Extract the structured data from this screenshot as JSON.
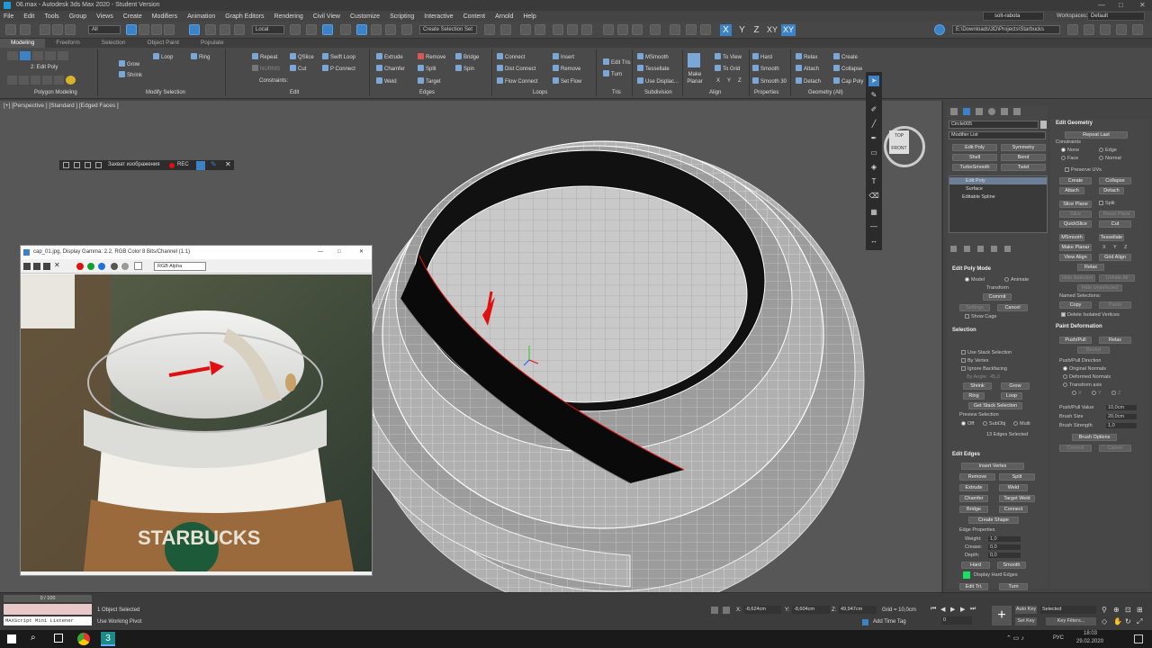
{
  "app": {
    "title": "06.max - Autodesk 3ds Max 2020 - Student Version",
    "menus": [
      "File",
      "Edit",
      "Tools",
      "Group",
      "Views",
      "Create",
      "Modifiers",
      "Animation",
      "Graph Editors",
      "Rendering",
      "Civil View",
      "Customize",
      "Scripting",
      "Interactive",
      "Content",
      "Arnold",
      "Help"
    ],
    "user": "solt-rabota",
    "workspace_label": "Workspaces:",
    "workspace_value": "Default"
  },
  "toolbar": {
    "filter_all": "All",
    "coord_local": "Local",
    "selection_set_placeholder": "Create Selection Set",
    "axis_x": "X",
    "axis_y": "Y",
    "axis_z": "Z",
    "axis_xy": "XY",
    "axis_xy2": "XY",
    "project_path": "E:\\Downloads\\3D\\Projects\\Starbucks"
  },
  "ribbon": {
    "tabs": [
      "Modeling",
      "Freeform",
      "Selection",
      "Object Paint",
      "Populate"
    ],
    "edit_poly_label": "2: Edit Poly",
    "groups": {
      "polygon_modeling": "Polygon Modeling",
      "modify_selection": "Modify Selection",
      "edit": "Edit",
      "edges": "Edges",
      "loops": "Loops",
      "tris": "Tris",
      "subdivision": "Subdivision",
      "align": "Align",
      "properties": "Properties",
      "geometry_all": "Geometry (All)"
    },
    "buttons": {
      "grow": "Grow",
      "shrink": "Shrink",
      "loop": "Loop",
      "ring": "Ring",
      "repeat": "Repeat",
      "qslice": "QSlice",
      "swift_loop": "Swift Loop",
      "nurms": "NURMS",
      "cut": "Cut",
      "p_connect": "P Connect",
      "constraints": "Constraints:",
      "extrude": "Extrude",
      "remove": "Remove",
      "bridge": "Bridge",
      "chamfer": "Chamfer",
      "split": "Split",
      "spin": "Spin",
      "weld": "Weld",
      "target": "Target",
      "connect": "Connect",
      "dist_connect": "Dist Connect",
      "flow_connect": "Flow Connect",
      "insert": "Insert",
      "remove2": "Remove",
      "set_flow": "Set Flow",
      "edit_tris": "Edit Tris",
      "turn": "Turn",
      "msmooth": "MSmooth",
      "tessellate": "Tessellate",
      "use_displac": "Use Displac...",
      "make_planar": "Make Planar",
      "to_view": "To View",
      "to_grid": "To Grid",
      "x": "X",
      "y": "Y",
      "z": "Z",
      "hard": "Hard",
      "smooth": "Smooth",
      "smooth30": "Smooth 30",
      "relax": "Relax",
      "attach": "Attach",
      "detach": "Detach",
      "create": "Create",
      "collapse": "Collapse",
      "cap_poly": "Cap Poly"
    }
  },
  "viewport": {
    "label": "[+] [Perspective ] [Standard ] [Edged Faces ]",
    "viewcube_top": "TOP",
    "viewcube_front": "FRONT"
  },
  "capture_bar": {
    "label": "Захват изображения",
    "rec": "REC"
  },
  "image_window": {
    "title": "cap_01.jpg, Display Gamma: 2.2, RGB Color 8 Bits/Channel (1:1)",
    "channel": "RGB Alpha",
    "cup_text": "STARBUCKS"
  },
  "command_panel": {
    "object_name": "Circle005",
    "modifier_list": "Modifier List",
    "mod_buttons": [
      "Edit Poly",
      "Symmetry",
      "Shell",
      "Bend",
      "TurboSmooth",
      "Twist"
    ],
    "stack": [
      "Edit Poly",
      "Surface",
      "Editable Spline"
    ],
    "edit_poly_mode": {
      "title": "Edit Poly Mode",
      "model": "Model",
      "animate": "Animate",
      "transform": "Transform",
      "commit": "Commit",
      "settings": "Settings",
      "cancel": "Cancel",
      "show_cage": "Show Cage"
    },
    "selection": {
      "title": "Selection",
      "use_stack": "Use Stack Selection",
      "by_vertex": "By Vertex",
      "ignore_backfacing": "Ignore Backfacing",
      "by_angle": "By Angle:",
      "by_angle_val": "45,0",
      "shrink": "Shrink",
      "grow": "Grow",
      "ring": "Ring",
      "loop": "Loop",
      "get_stack": "Get Stack Selection",
      "preview": "Preview Selection",
      "off": "Off",
      "subobj": "SubObj",
      "multi": "Multi",
      "status": "13 Edges Selected"
    },
    "edit_edges": {
      "title": "Edit Edges",
      "insert_vertex": "Insert Vertex",
      "remove": "Remove",
      "split": "Split",
      "extrude": "Extrude",
      "weld": "Weld",
      "chamfer": "Chamfer",
      "target_weld": "Target Weld",
      "bridge": "Bridge",
      "connect": "Connect",
      "create_shape": "Create Shape",
      "edge_props": "Edge Properties",
      "weight": "Weight:",
      "weight_val": "1,0",
      "crease": "Crease:",
      "crease_val": "0,0",
      "depth": "Depth:",
      "depth_val": "0,0",
      "hard": "Hard",
      "smooth": "Smooth",
      "display_hard": "Display Hard Edges",
      "edit_tri": "Edit Tri.",
      "turn": "Turn"
    },
    "edit_geometry": {
      "title": "Edit Geometry",
      "repeat_last": "Repeat Last",
      "constraints": "Constraints",
      "none": "None",
      "edge": "Edge",
      "face": "Face",
      "normal": "Normal",
      "preserve_uvs": "Preserve UVs",
      "create": "Create",
      "collapse": "Collapse",
      "attach": "Attach",
      "detach": "Detach",
      "slice_plane": "Slice Plane",
      "split": "Split",
      "slice": "Slice",
      "reset_plane": "Reset Plane",
      "quickslice": "QuickSlice",
      "cut": "Cut",
      "msmooth": "MSmooth",
      "tessellate": "Tessellate",
      "make_planar": "Make Planar",
      "x": "X",
      "y": "Y",
      "z": "Z",
      "view_align": "View Align",
      "grid_align": "Grid Align",
      "relax": "Relax",
      "hide_selected": "Hide Selected",
      "unhide_all": "Unhide All",
      "hide_unselected": "Hide Unselected",
      "named_selections": "Named Selections:",
      "copy": "Copy",
      "paste": "Paste",
      "delete_isolated": "Delete Isolated Vertices"
    },
    "paint_deformation": {
      "title": "Paint Deformation",
      "push_pull": "Push/Pull",
      "relax": "Relax",
      "revert": "Revert",
      "direction": "Push/Pull Direction",
      "original_normals": "Original Normals",
      "deformed_normals": "Deformed Normals",
      "transform_axis": "Transform axis",
      "x": "X",
      "y": "Y",
      "z": "Z",
      "value_label": "Push/Pull Value",
      "value": "10,0cm",
      "size_label": "Brush Size",
      "size": "20,0cm",
      "strength_label": "Brush Strength",
      "strength": "1,0",
      "brush_options": "Brush Options",
      "commit": "Commit",
      "cancel": "Cancel"
    }
  },
  "bottom": {
    "frame_counter": "0 / 100",
    "maxscript": "MAXScript Mini Listener",
    "status1": "1 Object Selected",
    "status2": "Use Working Pivot",
    "x_label": "X:",
    "x_val": "-8,624cm",
    "y_label": "Y:",
    "y_val": "-8,604cm",
    "z_label": "Z:",
    "z_val": "49,947cm",
    "grid": "Grid = 10,0cm",
    "add_time_tag": "Add Time Tag",
    "auto_key": "Auto Key",
    "set_key": "Set Key",
    "selected": "Selected",
    "key_filters": "Key Filters...",
    "frame_val": "0"
  },
  "taskbar": {
    "lang": "РУС",
    "time": "18:03",
    "date": "29.02.2020"
  },
  "colors": {
    "accent": "#3b82c7",
    "viewport_bg": "#575757",
    "panel_bg": "#444444",
    "selected_edge": "#e01010"
  }
}
